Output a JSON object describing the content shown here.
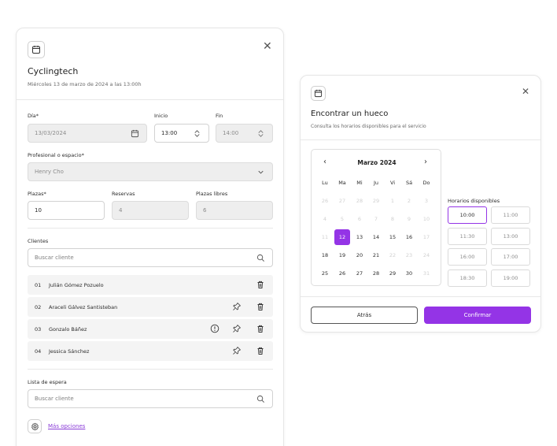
{
  "booking": {
    "title": "Cyclingtech",
    "subtitle": "Miércoles 13 de marzo de 2024 a las 13:00h",
    "day_label": "Día*",
    "day_value": "13/03/2024",
    "start_label": "Inicio",
    "start_value": "13:00",
    "end_label": "Fin",
    "end_value": "14:00",
    "professional_label": "Profesional o espacio*",
    "professional_value": "Henry Cho",
    "seats_label": "Plazas*",
    "seats_value": "10",
    "reservations_label": "Reservas",
    "reservations_value": "4",
    "free_label": "Plazas libres",
    "free_value": "6",
    "clients_label": "Clientes",
    "clients_search_placeholder": "Buscar cliente",
    "clients": [
      {
        "num": "01",
        "name": "Julián Gómez Pozuelo",
        "alert": false,
        "pin": false
      },
      {
        "num": "02",
        "name": "Araceli Gálvez Santisteban",
        "alert": false,
        "pin": true
      },
      {
        "num": "03",
        "name": "Gonzalo Báñez",
        "alert": true,
        "pin": true
      },
      {
        "num": "04",
        "name": "Jessica Sánchez",
        "alert": false,
        "pin": true
      }
    ],
    "waitlist_label": "Lista de espera",
    "waitlist_search_placeholder": "Buscar cliente",
    "more_options": "Más opciones"
  },
  "finder": {
    "title": "Encontrar un hueco",
    "subtitle": "Consulta los horarios disponibles para el servicio",
    "month": "Marzo 2024",
    "prev_icon": "‹",
    "next_icon": "›",
    "weekdays": [
      "Lu",
      "Ma",
      "Mi",
      "Ju",
      "Vi",
      "Sá",
      "Do"
    ],
    "weeks": [
      [
        {
          "d": "26",
          "f": true
        },
        {
          "d": "27",
          "f": true
        },
        {
          "d": "28",
          "f": true
        },
        {
          "d": "29",
          "f": true
        },
        {
          "d": "1",
          "f": true
        },
        {
          "d": "2",
          "f": true
        },
        {
          "d": "3",
          "f": true
        }
      ],
      [
        {
          "d": "4",
          "f": true
        },
        {
          "d": "5",
          "f": true
        },
        {
          "d": "6",
          "f": true
        },
        {
          "d": "7",
          "f": true
        },
        {
          "d": "8",
          "f": true
        },
        {
          "d": "9",
          "f": true
        },
        {
          "d": "10",
          "f": true
        }
      ],
      [
        {
          "d": "11",
          "f": true
        },
        {
          "d": "12",
          "f": false,
          "sel": true
        },
        {
          "d": "13",
          "f": false
        },
        {
          "d": "14",
          "f": false
        },
        {
          "d": "15",
          "f": false
        },
        {
          "d": "16",
          "f": false
        },
        {
          "d": "17",
          "f": true
        }
      ],
      [
        {
          "d": "18",
          "f": false
        },
        {
          "d": "19",
          "f": false
        },
        {
          "d": "20",
          "f": false
        },
        {
          "d": "21",
          "f": false
        },
        {
          "d": "22",
          "f": true
        },
        {
          "d": "23",
          "f": true
        },
        {
          "d": "24",
          "f": true
        }
      ],
      [
        {
          "d": "25",
          "f": false
        },
        {
          "d": "26",
          "f": false
        },
        {
          "d": "27",
          "f": false
        },
        {
          "d": "28",
          "f": false
        },
        {
          "d": "29",
          "f": false
        },
        {
          "d": "30",
          "f": false
        },
        {
          "d": "31",
          "f": true
        }
      ]
    ],
    "slots_title": "Horarios disponibles",
    "slots": [
      "10:00",
      "11:00",
      "11:30",
      "13:00",
      "16:00",
      "17:00",
      "18:30",
      "19:00"
    ],
    "selected_slot": "10:00",
    "back_label": "Atrás",
    "confirm_label": "Confirmar"
  },
  "colors": {
    "accent": "#9434e6",
    "link": "#8b3dd8"
  },
  "icons": {
    "calendar": "calendar-icon",
    "close": "close-icon",
    "stepper": "stepper-icon",
    "chevron": "chevron-down-icon",
    "search": "search-icon",
    "trash": "trash-icon",
    "pin": "pin-icon",
    "alert": "alert-icon",
    "gear": "gear-icon"
  },
  "close_glyph": "✕"
}
